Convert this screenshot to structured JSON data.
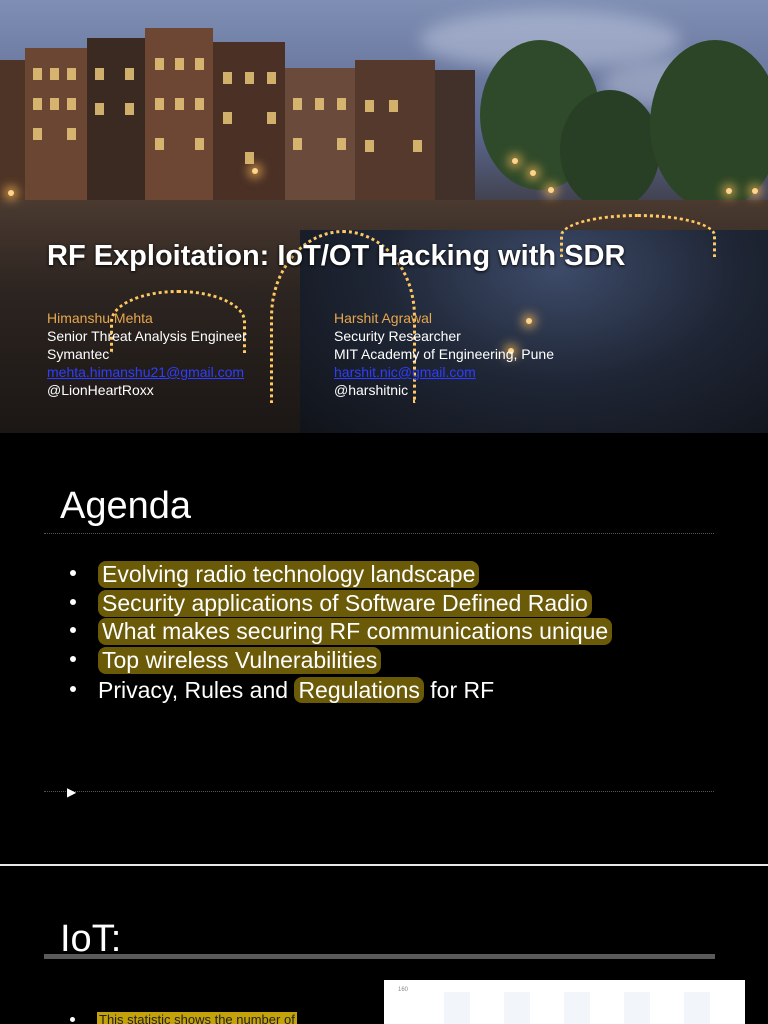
{
  "slide1": {
    "title": "RF Exploitation: IoT/OT Hacking with SDR",
    "author1": {
      "name": "Himanshu Mehta",
      "role": "Senior Threat Analysis Engineer",
      "org": "Symantec",
      "email": "mehta.himanshu21@gmail.com",
      "handle": "@LionHeartRoxx"
    },
    "author2": {
      "name": "Harshit Agrawal",
      "role": "Security Researcher",
      "org": "MIT Academy of Engineering, Pune",
      "email": "harshit.nic@gmail.com",
      "handle": "@harshitnic"
    }
  },
  "slide2": {
    "heading": "Agenda",
    "bullets": [
      "Evolving radio technology landscape",
      "Security applications of Software Defined Radio",
      "What makes securing RF communications unique",
      "Top wireless Vulnerabilities"
    ],
    "last_bullet_plain1": "Privacy, Rules and ",
    "last_bullet_highlight": "Regulations",
    "last_bullet_plain2": " for RF",
    "arrow": "▶"
  },
  "slide3": {
    "heading": "IoT:",
    "chart_axis_label": "160",
    "bullet": "This statistic shows the number of"
  },
  "colors": {
    "highlight": "#6b5a08",
    "author_name": "#e7a74e",
    "email_link": "#2f3dff"
  }
}
